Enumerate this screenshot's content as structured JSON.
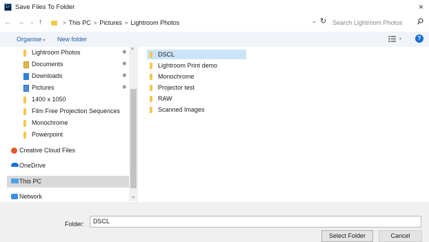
{
  "window": {
    "title": "Save Files To Folder",
    "app_icon_text": "Lr",
    "close_glyph": "×"
  },
  "nav": {
    "back": "←",
    "forward": "→",
    "recent": "⌄",
    "up": "↑",
    "breadcrumb": [
      "This PC",
      "Pictures",
      "Lightroom Photos"
    ],
    "sep": ">",
    "dropdown": "⌄",
    "refresh": "↻",
    "search_placeholder": "Search Lightroom Photos",
    "search_icon": "⚲"
  },
  "toolbar": {
    "organise": "Organise",
    "organise_caret": "▾",
    "new_folder": "New folder",
    "view_glyph": "☷",
    "view_caret": "▾",
    "help": "?"
  },
  "sidebar": {
    "items": [
      {
        "label": "Lightroom Photos",
        "icon": "folder-icon",
        "pinned": true
      },
      {
        "label": "Documents",
        "icon": "documents-icon",
        "pinned": true
      },
      {
        "label": "Downloads",
        "icon": "downloads-icon",
        "pinned": true
      },
      {
        "label": "Pictures",
        "icon": "pictures-icon",
        "pinned": true
      },
      {
        "label": "1400 x 1050",
        "icon": "folder-icon",
        "pinned": false
      },
      {
        "label": "Film Free Projection Sequences",
        "icon": "folder-icon",
        "pinned": false
      },
      {
        "label": "Monochrome",
        "icon": "folder-icon",
        "pinned": false
      },
      {
        "label": "Powerpoint",
        "icon": "folder-icon",
        "pinned": false
      },
      {
        "label": "Creative Cloud Files",
        "icon": "creative-cloud-icon",
        "pinned": false
      },
      {
        "label": "OneDrive",
        "icon": "onedrive-icon",
        "pinned": false
      },
      {
        "label": "This PC",
        "icon": "this-pc-icon",
        "pinned": false,
        "selected": true
      },
      {
        "label": "Network",
        "icon": "network-icon",
        "pinned": false
      }
    ],
    "pin_glyph": "✱",
    "scroll_up": "^",
    "scroll_down": "⌄"
  },
  "content": {
    "items": [
      {
        "label": "DSCL",
        "selected": true
      },
      {
        "label": "Lightroom Print demo"
      },
      {
        "label": "Monochrome"
      },
      {
        "label": "Projector test"
      },
      {
        "label": "RAW"
      },
      {
        "label": "Scanned Images"
      }
    ]
  },
  "footer": {
    "folder_label": "Folder:",
    "folder_value": "DSCL",
    "select_button": "Select Folder",
    "cancel_button": "Cancel"
  }
}
